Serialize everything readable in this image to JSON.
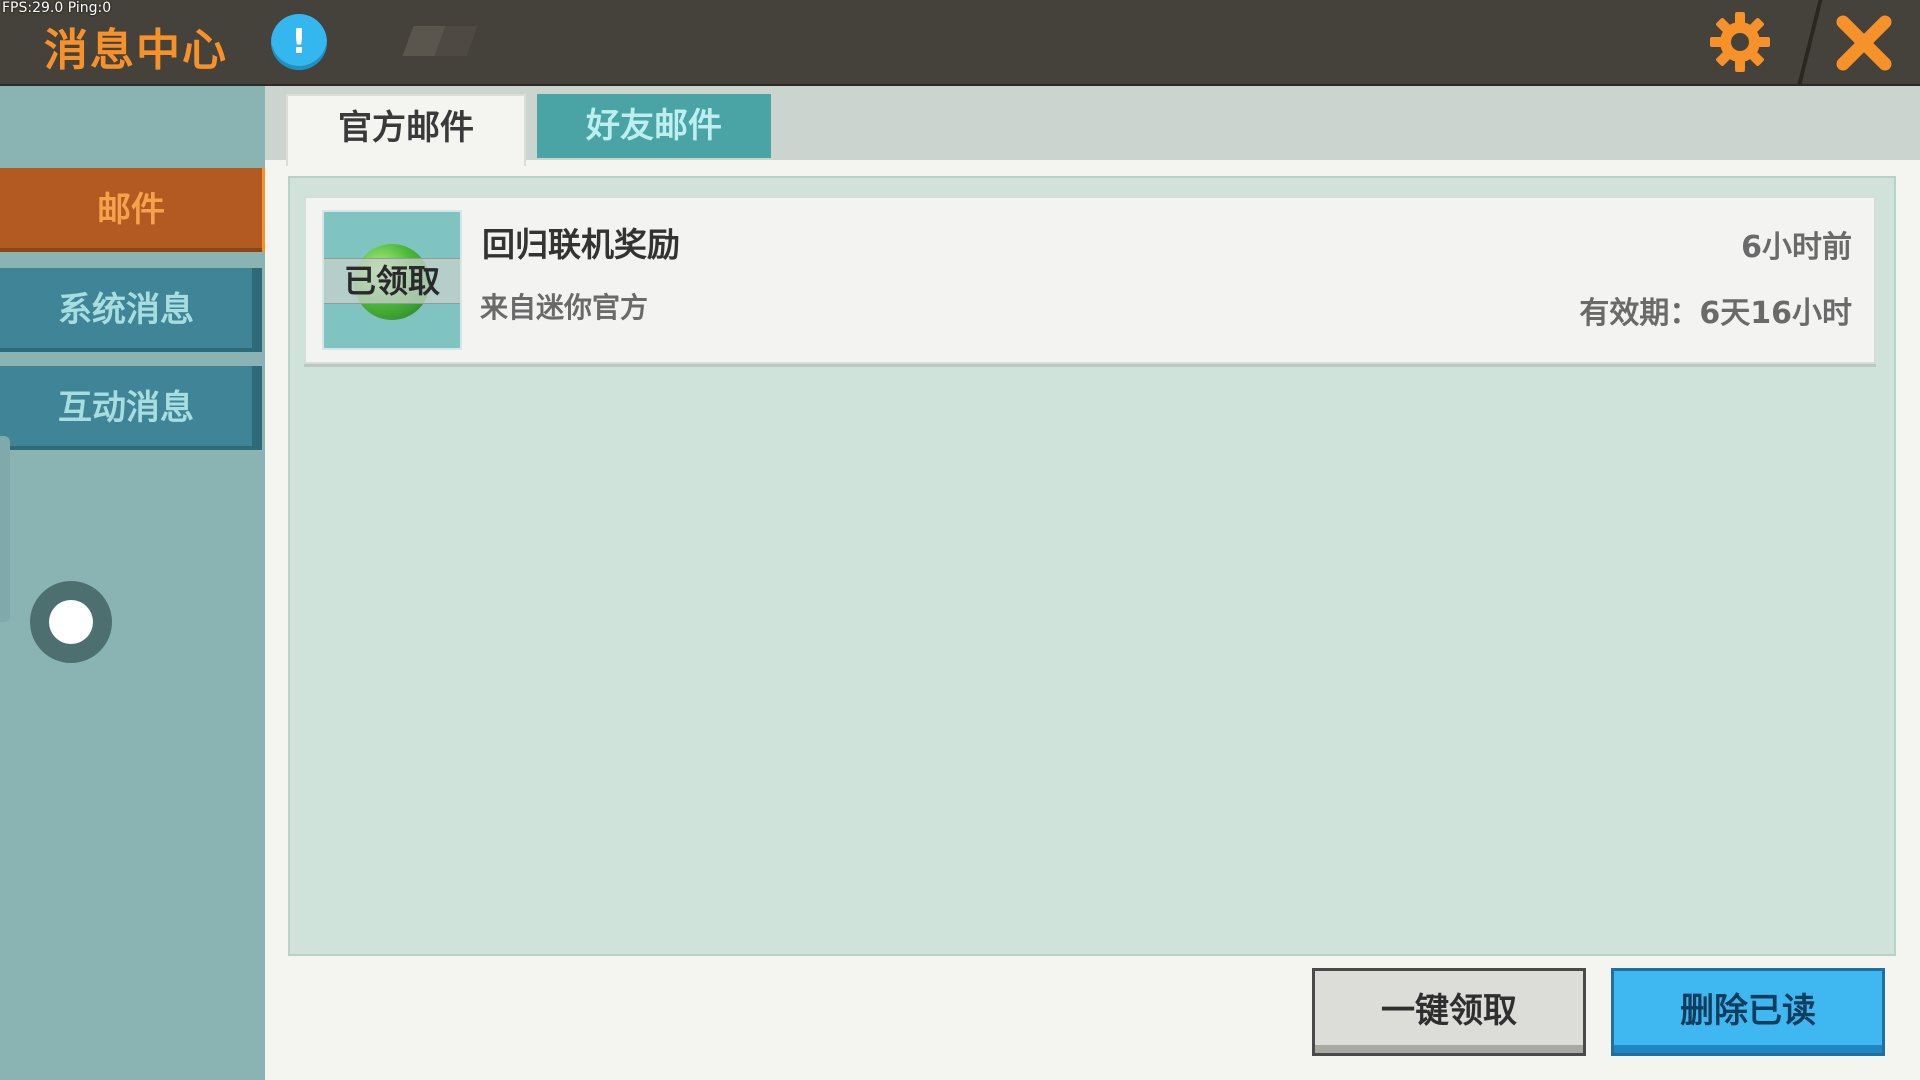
{
  "debug": {
    "fps_text": "FPS:29.0  Ping:0"
  },
  "header": {
    "title": "消息中心",
    "info_icon": "info-icon",
    "info_symbol": "!",
    "settings_icon": "gear-icon",
    "close_icon": "close-icon"
  },
  "sidebar": {
    "items": [
      {
        "label": "邮件",
        "active": true
      },
      {
        "label": "系统消息",
        "active": false
      },
      {
        "label": "互动消息",
        "active": false
      }
    ]
  },
  "tabs": [
    {
      "label": "官方邮件",
      "active": true
    },
    {
      "label": "好友邮件",
      "active": false
    }
  ],
  "mails": [
    {
      "title": "回归联机奖励",
      "from": "来自迷你官方",
      "time": "6小时前",
      "expiry": "有效期：6天16小时",
      "status": "已领取",
      "icon": "green-orb-icon"
    }
  ],
  "actions": {
    "claim_all": "一键领取",
    "delete_read": "删除已读"
  },
  "colors": {
    "accent_orange": "#f7922a",
    "topbar": "#45413b",
    "sidebar_bg": "#8ab4b4",
    "tab_inactive": "#4aa3a5",
    "button_blue": "#3fb8f2"
  }
}
